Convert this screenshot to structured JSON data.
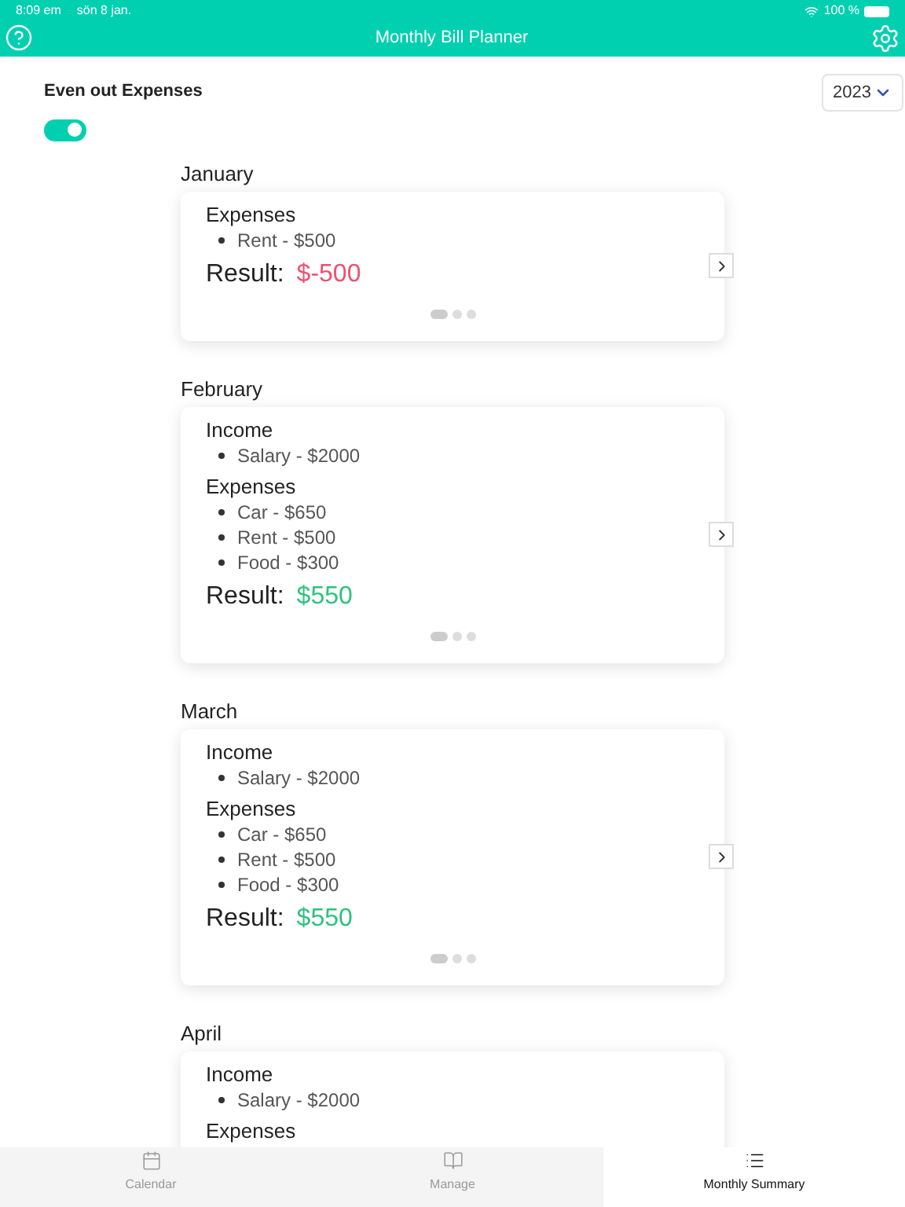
{
  "status_bar": {
    "time": "8:09 em",
    "date": "sön 8 jan.",
    "battery": "100 %"
  },
  "header": {
    "title": "Monthly Bill Planner"
  },
  "controls": {
    "toggle_label": "Even out Expenses",
    "toggle_on": true,
    "year": "2023"
  },
  "months": [
    {
      "name": "January",
      "sections": [
        {
          "title": "Expenses",
          "items": [
            "Rent - $500"
          ]
        }
      ],
      "result_label": "Result:",
      "result": "$-500",
      "color": "#f0506e",
      "pages": [
        {
          "selected": true
        },
        {
          "selected": false
        },
        {
          "selected": false
        }
      ]
    },
    {
      "name": "February",
      "sections": [
        {
          "title": "Income",
          "items": [
            "Salary - $2000"
          ]
        },
        {
          "title": "Expenses",
          "items": [
            "Car - $650",
            "Rent - $500",
            "Food - $300"
          ]
        }
      ],
      "result_label": "Result:",
      "result": "$550",
      "color": "#2ec27e",
      "pages": [
        {
          "selected": true
        },
        {
          "selected": false
        },
        {
          "selected": false
        }
      ]
    },
    {
      "name": "March",
      "sections": [
        {
          "title": "Income",
          "items": [
            "Salary - $2000"
          ]
        },
        {
          "title": "Expenses",
          "items": [
            "Car - $650",
            "Rent - $500",
            "Food - $300"
          ]
        }
      ],
      "result_label": "Result:",
      "result": "$550",
      "color": "#2ec27e",
      "pages": [
        {
          "selected": true
        },
        {
          "selected": false
        },
        {
          "selected": false
        }
      ]
    },
    {
      "name": "April",
      "sections": [
        {
          "title": "Income",
          "items": [
            "Salary - $2000"
          ]
        },
        {
          "title": "Expenses"
        }
      ]
    }
  ],
  "tabs": [
    {
      "label": "Calendar",
      "kind": "calendar",
      "selected": false
    },
    {
      "label": "Manage",
      "kind": "book",
      "selected": false
    },
    {
      "label": "Monthly Summary",
      "kind": "list",
      "selected": true
    }
  ]
}
